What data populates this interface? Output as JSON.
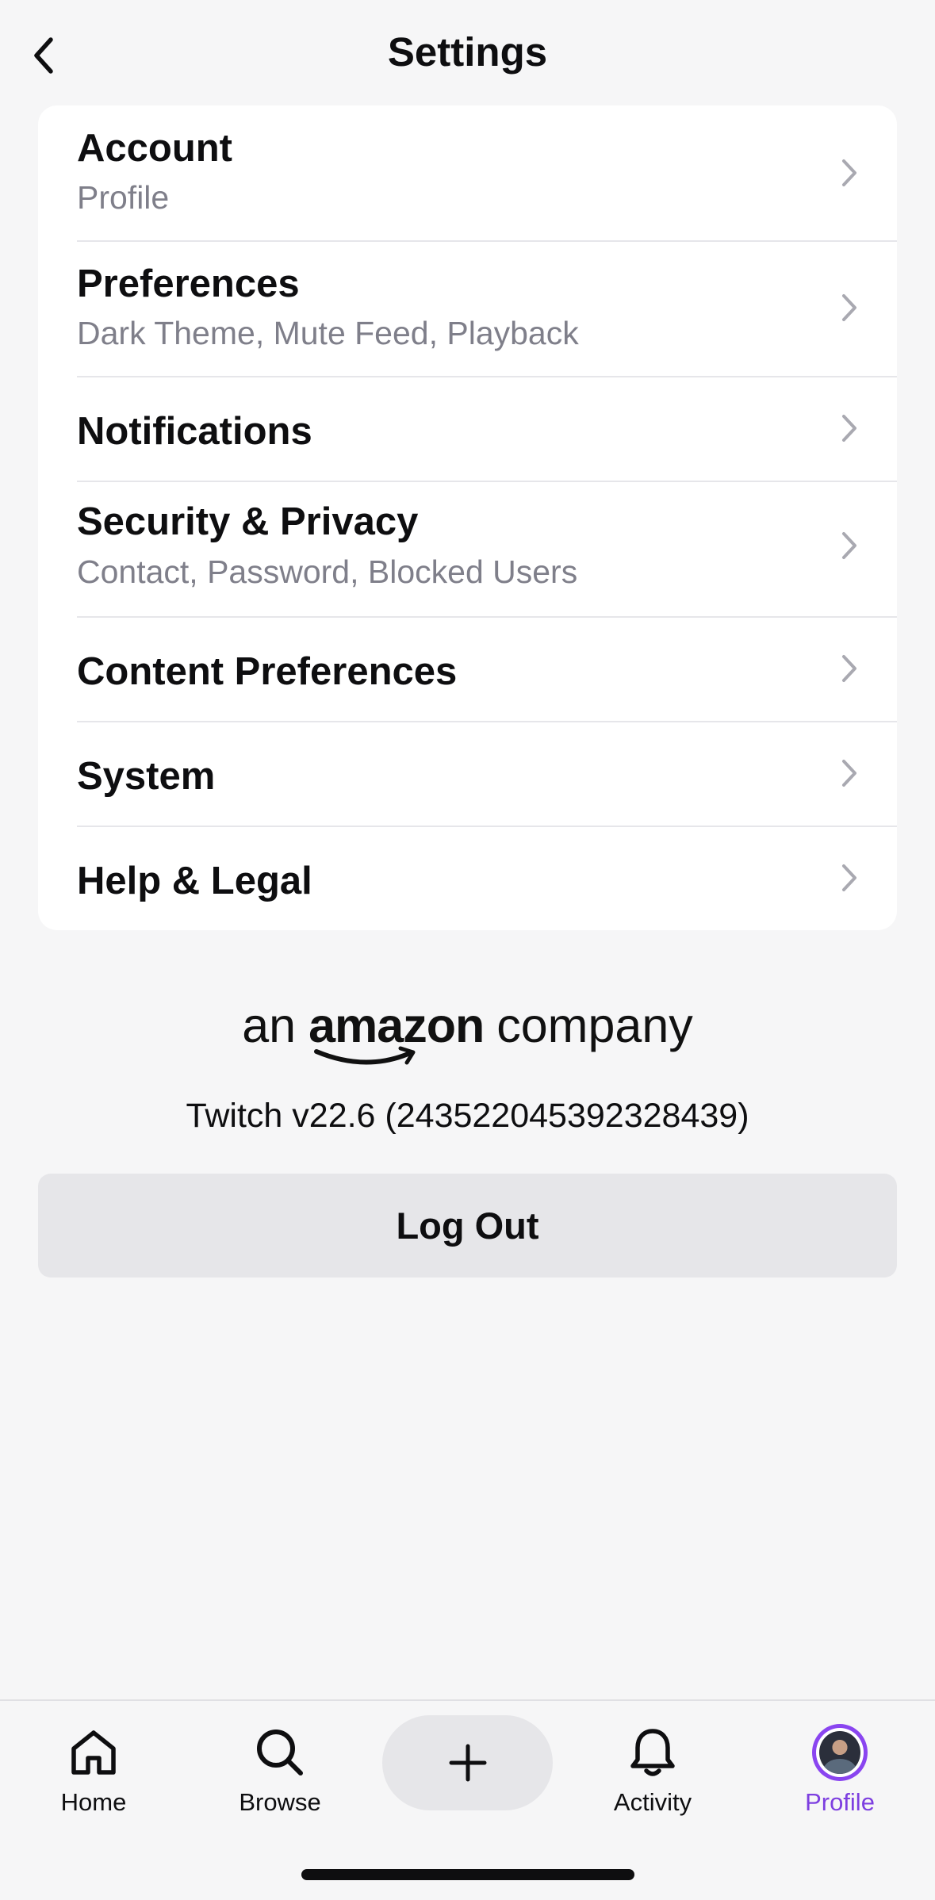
{
  "header": {
    "title": "Settings"
  },
  "settings": {
    "items": [
      {
        "label": "Account",
        "sub": "Profile"
      },
      {
        "label": "Preferences",
        "sub": "Dark Theme, Mute Feed, Playback"
      },
      {
        "label": "Notifications",
        "sub": ""
      },
      {
        "label": "Security & Privacy",
        "sub": "Contact, Password, Blocked Users"
      },
      {
        "label": "Content Preferences",
        "sub": ""
      },
      {
        "label": "System",
        "sub": ""
      },
      {
        "label": "Help & Legal",
        "sub": ""
      }
    ]
  },
  "branding": {
    "prefix": "an",
    "brand": "amazon",
    "suffix": "company"
  },
  "version": "Twitch v22.6 (2435220453923284​39)",
  "logout_label": "Log Out",
  "nav": {
    "items": [
      {
        "label": "Home",
        "icon": "home-icon"
      },
      {
        "label": "Browse",
        "icon": "search-icon"
      },
      {
        "label": "",
        "icon": "plus-icon"
      },
      {
        "label": "Activity",
        "icon": "bell-icon"
      },
      {
        "label": "Profile",
        "icon": "avatar"
      }
    ]
  },
  "colors": {
    "accent": "#8a45f0",
    "background": "#f6f6f7",
    "card": "#ffffff",
    "subtext": "#7f7f8a"
  }
}
